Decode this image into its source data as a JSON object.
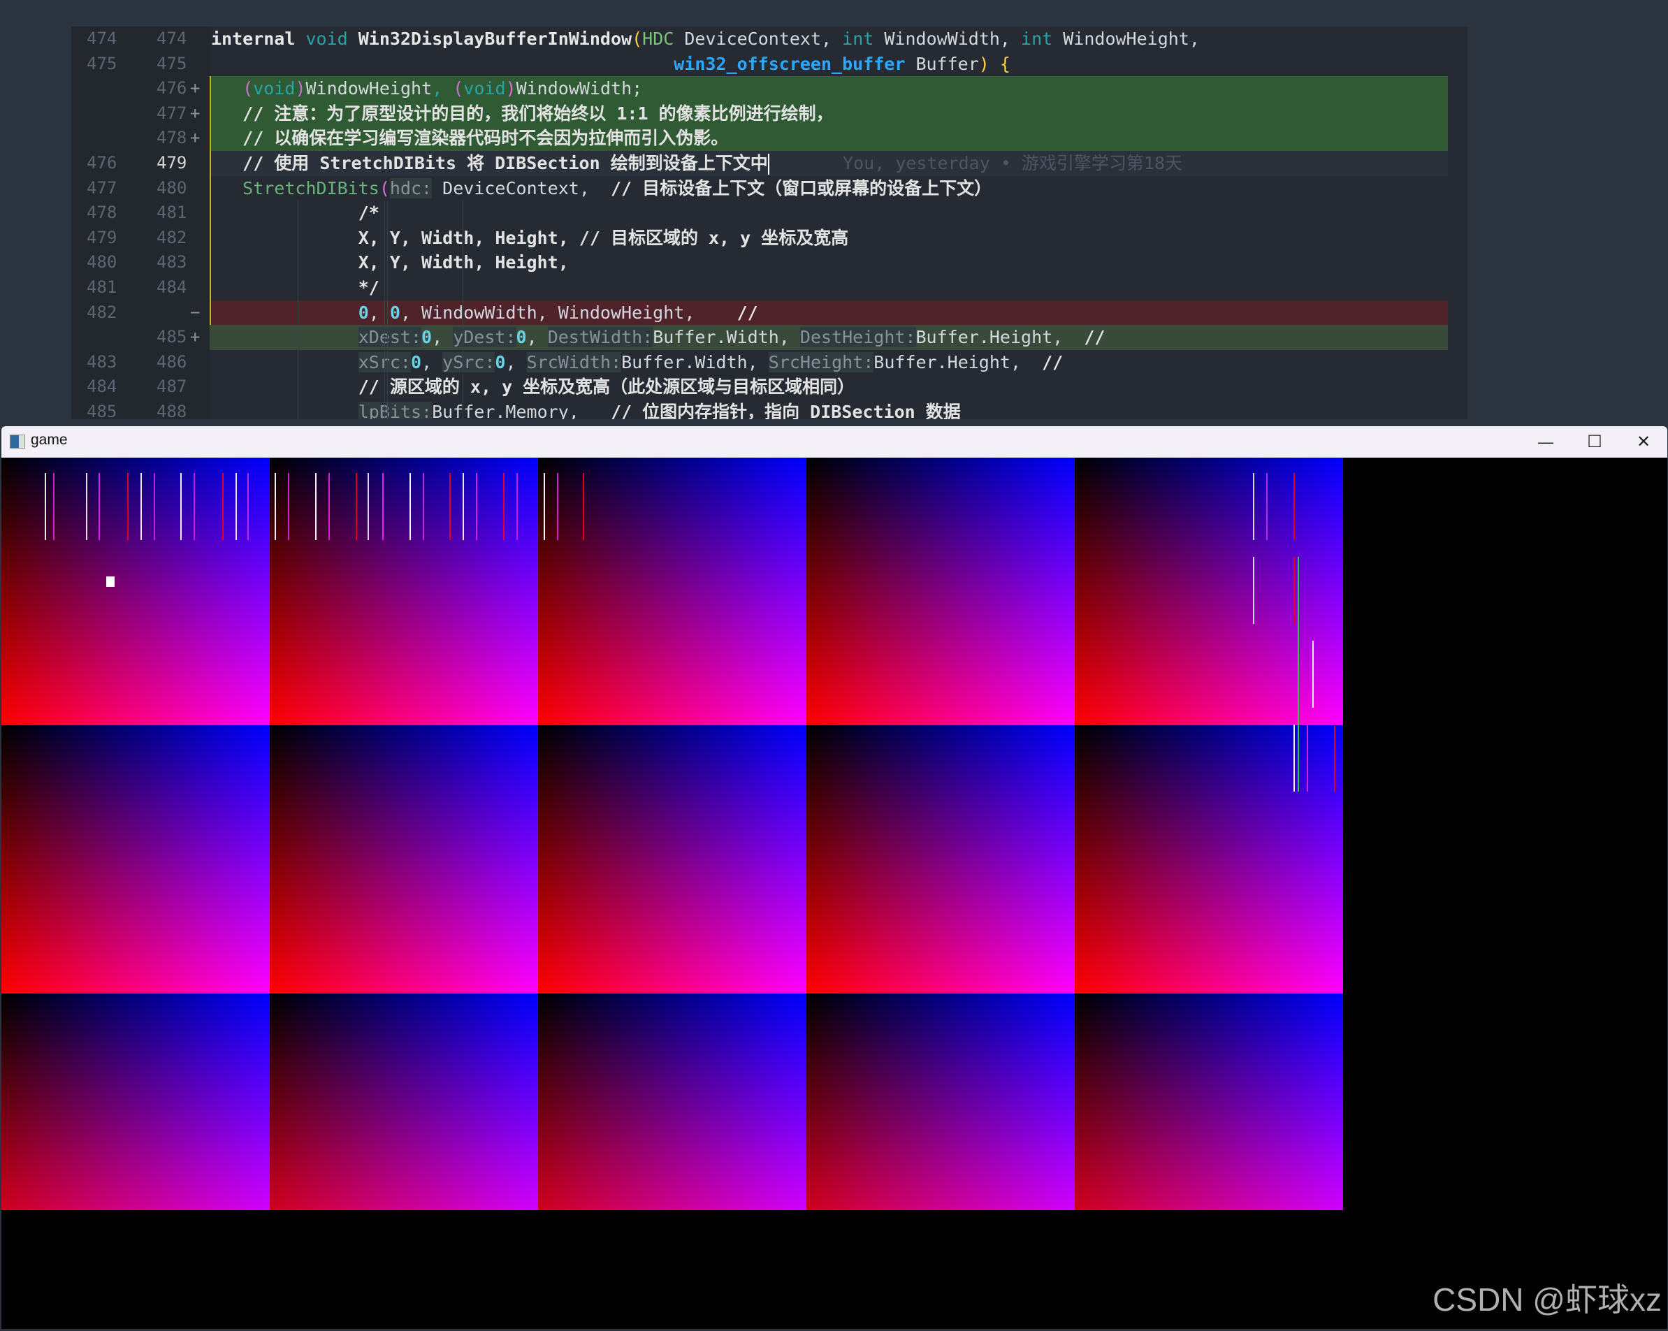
{
  "editor": {
    "lines": [
      {
        "old": "474",
        "new": "474",
        "kind": "normal",
        "segments": [
          [
            "fn",
            "internal "
          ],
          [
            "kw",
            "void "
          ],
          [
            "fn",
            "Win32DisplayBufferInWindow"
          ],
          [
            "par",
            "("
          ],
          [
            "ty",
            "HDC "
          ],
          [
            "plain",
            "DeviceContext, "
          ],
          [
            "kw",
            "int "
          ],
          [
            "plain",
            "WindowWidth, "
          ],
          [
            "kw",
            "int "
          ],
          [
            "plain",
            "WindowHeight,"
          ]
        ]
      },
      {
        "old": "475",
        "new": "475",
        "kind": "normal",
        "indent": "                                            ",
        "segments": [
          [
            "blue-bold",
            "win32_offscreen_buffer "
          ],
          [
            "plain",
            "Buffer"
          ],
          [
            "par",
            ")"
          ],
          [
            "plain",
            " "
          ],
          [
            "par",
            "{"
          ]
        ]
      },
      {
        "old": "",
        "new": "476",
        "mark": "+",
        "kind": "added",
        "indent": "   ",
        "segments": [
          [
            "pink",
            "("
          ],
          [
            "kw",
            "void"
          ],
          [
            "pink",
            ")"
          ],
          [
            "plain",
            "WindowHeight"
          ],
          [
            "kw",
            ", "
          ],
          [
            "pink",
            "("
          ],
          [
            "kw",
            "void"
          ],
          [
            "pink",
            ")"
          ],
          [
            "plain",
            "WindowWidth;"
          ]
        ]
      },
      {
        "old": "",
        "new": "477",
        "mark": "+",
        "kind": "added",
        "indent": "   ",
        "segments": [
          [
            "cmt",
            "// 注意：为了原型设计的目的，我们将始终以 1:1 的像素比例进行绘制，"
          ]
        ]
      },
      {
        "old": "",
        "new": "478",
        "mark": "+",
        "kind": "added",
        "indent": "   ",
        "segments": [
          [
            "cmt",
            "// 以确保在学习编写渲染器代码时不会因为拉伸而引入伪影。"
          ]
        ]
      },
      {
        "old": "476",
        "new": "479",
        "kind": "current",
        "indent": "   ",
        "segments": [
          [
            "cmt",
            "// 使用 StretchDIBits 将 DIBSection 绘制到设备上下文中"
          ]
        ],
        "blame": "You, yesterday • 游戏引擎学习第18天"
      },
      {
        "old": "477",
        "new": "480",
        "kind": "normal",
        "indent": "   ",
        "segments": [
          [
            "green-fn",
            "StretchDIBits"
          ],
          [
            "pink",
            "("
          ],
          [
            "hint",
            "hdc:"
          ],
          [
            "plain",
            " DeviceContext,  "
          ],
          [
            "cmt",
            "// 目标设备上下文（窗口或屏幕的设备上下文）"
          ]
        ]
      },
      {
        "old": "478",
        "new": "481",
        "kind": "normal",
        "indent": "              ",
        "segments": [
          [
            "cmt",
            "/*"
          ]
        ]
      },
      {
        "old": "479",
        "new": "482",
        "kind": "normal",
        "indent": "              ",
        "segments": [
          [
            "cmt",
            "X, Y, Width, Height, // 目标区域的 x, y 坐标及宽高"
          ]
        ]
      },
      {
        "old": "480",
        "new": "483",
        "kind": "normal",
        "indent": "              ",
        "segments": [
          [
            "cmt",
            "X, Y, Width, Height,"
          ]
        ]
      },
      {
        "old": "481",
        "new": "484",
        "kind": "normal",
        "indent": "              ",
        "segments": [
          [
            "cmt",
            "*/"
          ]
        ]
      },
      {
        "old": "482",
        "new": "",
        "mark": "−",
        "kind": "removed",
        "indent": "              ",
        "segments": [
          [
            "num",
            "0"
          ],
          [
            "plain",
            ", "
          ],
          [
            "num",
            "0"
          ],
          [
            "plain",
            ", WindowWidth, WindowHeight,    "
          ],
          [
            "cmt",
            "//"
          ]
        ]
      },
      {
        "old": "",
        "new": "485",
        "mark": "+",
        "kind": "added2",
        "indent": "              ",
        "segments": [
          [
            "hint",
            "xDest:"
          ],
          [
            "num",
            "0"
          ],
          [
            "plain",
            ", "
          ],
          [
            "hint",
            "yDest:"
          ],
          [
            "num",
            "0"
          ],
          [
            "plain",
            ", "
          ],
          [
            "hint",
            "DestWidth:"
          ],
          [
            "plain",
            "Buffer.Width, "
          ],
          [
            "hint",
            "DestHeight:"
          ],
          [
            "plain",
            "Buffer.Height,  "
          ],
          [
            "cmt",
            "//"
          ]
        ]
      },
      {
        "old": "483",
        "new": "486",
        "kind": "normal",
        "indent": "              ",
        "segments": [
          [
            "hint",
            "xSrc:"
          ],
          [
            "num",
            "0"
          ],
          [
            "plain",
            ", "
          ],
          [
            "hint",
            "ySrc:"
          ],
          [
            "num",
            "0"
          ],
          [
            "plain",
            ", "
          ],
          [
            "hint",
            "SrcWidth:"
          ],
          [
            "plain",
            "Buffer.Width, "
          ],
          [
            "hint",
            "SrcHeight:"
          ],
          [
            "plain",
            "Buffer.Height,  "
          ],
          [
            "cmt",
            "//"
          ]
        ]
      },
      {
        "old": "484",
        "new": "487",
        "kind": "normal",
        "indent": "              ",
        "segments": [
          [
            "cmt",
            "// 源区域的 x, y 坐标及宽高（此处源区域与目标区域相同）"
          ]
        ]
      },
      {
        "old": "485",
        "new": "488",
        "kind": "normal",
        "indent": "              ",
        "segments": [
          [
            "hint",
            "lpBits:"
          ],
          [
            "plain",
            "Buffer.Memory,   "
          ],
          [
            "cmt",
            "// 位图内存指针，指向 DIBSection 数据"
          ]
        ]
      }
    ]
  },
  "game_window": {
    "title": "game",
    "icon": "app-window-icon",
    "controls": {
      "minimize": "—",
      "maximize": "☐",
      "close": "✕"
    },
    "tiles": {
      "columns": 5,
      "rows": 3
    },
    "colors": {
      "tile_top_left": "#000000",
      "tile_top_right": "#0000ff",
      "tile_bottom_left": "#ff0000",
      "tile_bottom_right": "#ff00ff",
      "background": "#000000"
    }
  },
  "watermark": "CSDN @虾球xz"
}
